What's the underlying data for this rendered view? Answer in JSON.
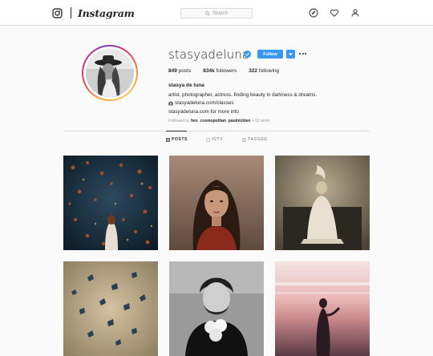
{
  "nav": {
    "brand": "Instagram",
    "search_placeholder": "Search"
  },
  "profile": {
    "username": "stasyadeluna",
    "follow_label": "Follow",
    "stats": {
      "posts_count": "849",
      "posts_label": "posts",
      "followers_count": "834k",
      "followers_label": "followers",
      "following_count": "322",
      "following_label": "following"
    },
    "full_name": "stasya de luna",
    "bio_line1": "artist, photographer, actress. finding beauty in darkness & dreams.",
    "bio_line2": "stasyadeluna.com/classes",
    "bio_line3": "stasyadeluna.com for more info",
    "followed_prefix": "Followed by",
    "followed_user1": "hex",
    "followed_user2": "cosmopolitan",
    "followed_user3": "paulnicklen",
    "followed_suffix": "+ 62 more"
  },
  "tabs": [
    {
      "label": "POSTS",
      "icon": "grid-icon",
      "active": true
    },
    {
      "label": "IGTV",
      "icon": "tv-icon",
      "active": false
    },
    {
      "label": "TAGGED",
      "icon": "tag-icon",
      "active": false
    }
  ],
  "posts": [
    {
      "subject": "woman among autumn leaves, dark blue"
    },
    {
      "subject": "portrait of young woman"
    },
    {
      "subject": "figure with moon, sepia"
    },
    {
      "subject": "butterflies on beige"
    },
    {
      "subject": "man holding flowers, black and white"
    },
    {
      "subject": "silhouette at sunset beach"
    }
  ],
  "colors": {
    "accent": "#3897f0",
    "border": "#dbdbdb",
    "background": "#fafafa",
    "muted": "#999999"
  }
}
